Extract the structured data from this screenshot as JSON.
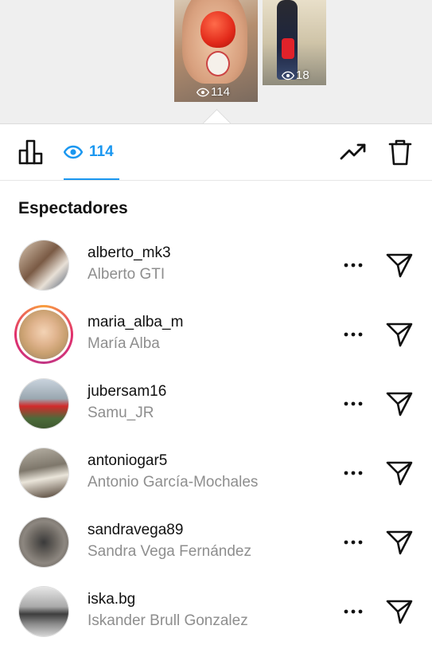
{
  "stories": [
    {
      "views": "114"
    },
    {
      "views": "18"
    }
  ],
  "toolbar": {
    "views_count": "114",
    "accent_color": "#1a97f0"
  },
  "section_title": "Espectadores",
  "viewers": [
    {
      "username": "alberto_mk3",
      "fullname": "Alberto GTI",
      "has_story_ring": false
    },
    {
      "username": "maria_alba_m",
      "fullname": "María Alba",
      "has_story_ring": true
    },
    {
      "username": "jubersam16",
      "fullname": "Samu_JR",
      "has_story_ring": false
    },
    {
      "username": "antoniogar5",
      "fullname": "Antonio García-Mochales",
      "has_story_ring": false
    },
    {
      "username": "sandravega89",
      "fullname": "Sandra Vega Fernández",
      "has_story_ring": false
    },
    {
      "username": "iska.bg",
      "fullname": "Iskander Brull Gonzalez",
      "has_story_ring": false
    }
  ],
  "icons": {
    "stats": "bar-chart-icon",
    "views": "eye-icon",
    "insights": "trend-up-icon",
    "delete": "trash-icon",
    "more": "more-horizontal-icon",
    "send": "send-icon"
  }
}
